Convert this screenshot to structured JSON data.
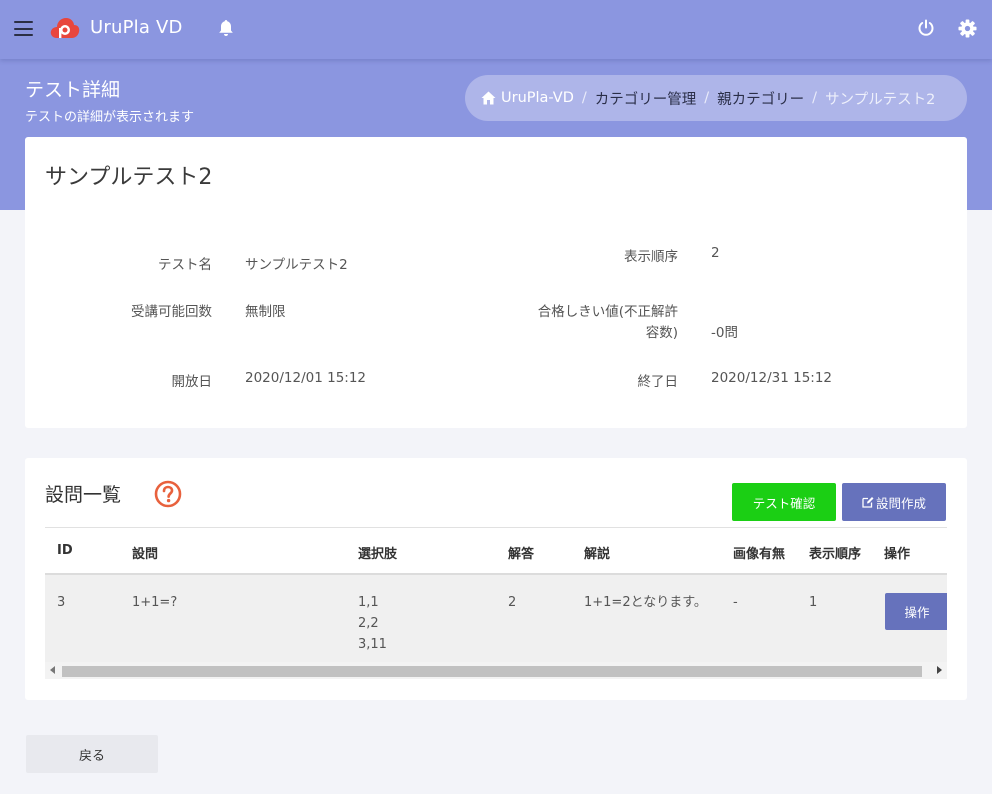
{
  "app": {
    "title": "UruPla VD"
  },
  "header": {
    "page_title": "テスト詳細",
    "page_subtitle": "テストの詳細が表示されます"
  },
  "breadcrumb": [
    {
      "label": "UruPla-VD"
    },
    {
      "label": "カテゴリー管理"
    },
    {
      "label": "親カテゴリー"
    },
    {
      "label": "サンプルテスト2"
    }
  ],
  "breadcrumb_separator": "/",
  "detail": {
    "title": "サンプルテスト2",
    "fields": {
      "name_label": "テスト名",
      "name_value": "サンプルテスト2",
      "order_label": "表示順序",
      "order_value": "2",
      "attempts_label": "受講可能回数",
      "attempts_value": "無制限",
      "threshold_label_line1": "合格しきい値(不正解許",
      "threshold_label_line2": "容数)",
      "threshold_value": "-0問",
      "open_label": "開放日",
      "open_value": "2020/12/01 15:12",
      "end_label": "終了日",
      "end_value": "2020/12/31 15:12"
    }
  },
  "questions": {
    "title": "設問一覧",
    "confirm_button": "テスト確認",
    "create_button": "設問作成",
    "columns": [
      "ID",
      "設問",
      "選択肢",
      "解答",
      "解説",
      "画像有無",
      "表示順序",
      "操作"
    ],
    "rows": [
      {
        "id": "3",
        "question": "1+1=?",
        "choices": [
          "1,1",
          "2,2",
          "3,11"
        ],
        "answer": "2",
        "explanation": "1+1=2となります。",
        "has_image": "-",
        "order": "1",
        "action": "操作"
      }
    ]
  },
  "back_button": "戻る",
  "colors": {
    "header_bg": "#8b96e0",
    "green": "#1bcf14",
    "indigo": "#6672bc",
    "logo_red": "#e8463d",
    "help_orange": "#e8613d"
  },
  "icons": {
    "menu": "hamburger-icon",
    "logo": "cloud-logo-icon",
    "notifications": "bell-icon",
    "power": "power-icon",
    "settings": "gear-icon",
    "home": "home-icon",
    "help": "question-circle-icon",
    "edit": "edit-icon"
  }
}
